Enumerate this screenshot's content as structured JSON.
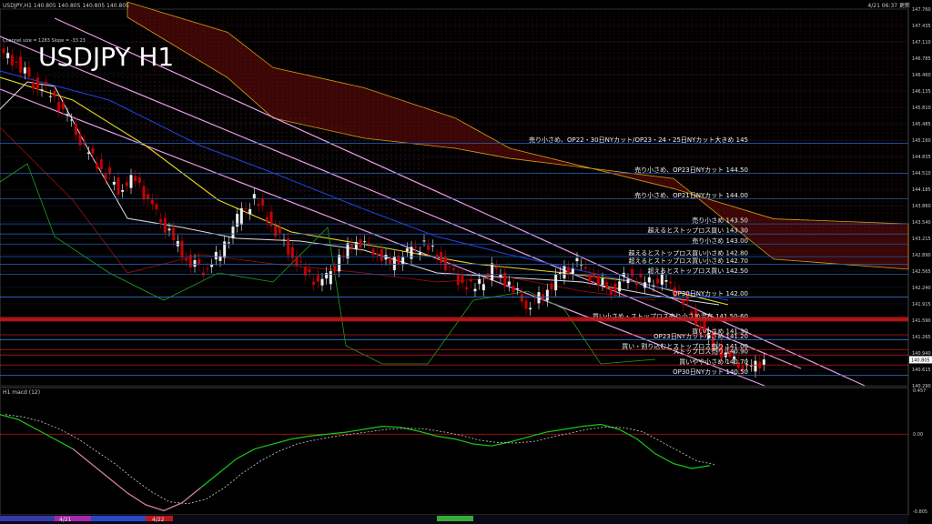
{
  "window": {
    "header_left": "USDJPY,H1 140.805 140.805 140.805 140.805",
    "header_right": "4/21 06:37 更新",
    "channel_info": "Channel size = 1283 Slope = -33.23",
    "big_title": "USDJPY  H1"
  },
  "sub_window": {
    "label": "H1  macd (12)",
    "axis_top": "0.457",
    "axis_mid": "0.00",
    "axis_bottom": "-0.805"
  },
  "date_labels": [
    "4/21",
    "4/22"
  ],
  "price_axis": [
    {
      "v": 147.76,
      "t": "147.760"
    },
    {
      "v": 147.435,
      "t": "147.435"
    },
    {
      "v": 147.11,
      "t": "147.110"
    },
    {
      "v": 146.785,
      "t": "146.785"
    },
    {
      "v": 146.46,
      "t": "146.460"
    },
    {
      "v": 146.135,
      "t": "146.135"
    },
    {
      "v": 145.81,
      "t": "145.810"
    },
    {
      "v": 145.485,
      "t": "145.485"
    },
    {
      "v": 145.16,
      "t": "145.160"
    },
    {
      "v": 144.835,
      "t": "144.835"
    },
    {
      "v": 144.51,
      "t": "144.510"
    },
    {
      "v": 144.185,
      "t": "144.185"
    },
    {
      "v": 143.86,
      "t": "143.860"
    },
    {
      "v": 143.54,
      "t": "143.540"
    },
    {
      "v": 143.215,
      "t": "143.215"
    },
    {
      "v": 142.89,
      "t": "142.890"
    },
    {
      "v": 142.565,
      "t": "142.565"
    },
    {
      "v": 142.24,
      "t": "142.240"
    },
    {
      "v": 141.915,
      "t": "141.915"
    },
    {
      "v": 141.59,
      "t": "141.590"
    },
    {
      "v": 141.265,
      "t": "141.265"
    },
    {
      "v": 140.94,
      "t": "140.940"
    },
    {
      "v": 140.615,
      "t": "140.615"
    },
    {
      "v": 140.29,
      "t": "140.290"
    }
  ],
  "current_price": {
    "v": 140.805,
    "t": "140.805"
  },
  "annotations": [
    {
      "text": "売り小さめ、OP22・30日NYカット/OP23・24・25日NYカット大きめ 145",
      "price": 145.1,
      "kind": "sell"
    },
    {
      "text": "売り小さめ、OP23日NYカット 144.50",
      "price": 144.5,
      "kind": "sell"
    },
    {
      "text": "売り小さめ、OP21日NYカット 144.00",
      "price": 144.0,
      "kind": "sell"
    },
    {
      "text": "売り小さめ 143.50",
      "price": 143.5,
      "kind": "sell"
    },
    {
      "text": "超えるとストップロス買い 143.30",
      "price": 143.3,
      "kind": "stop"
    },
    {
      "text": "売り小さめ 143.00",
      "price": 143.1,
      "kind": "sell"
    },
    {
      "text": "超えるとストップロス買い小さめ 142.80",
      "price": 142.85,
      "kind": "stop"
    },
    {
      "text": "超えるとストップロス買い小さめ 142.70",
      "price": 142.7,
      "kind": "stop"
    },
    {
      "text": "超えるとストップロス買い 142.50",
      "price": 142.5,
      "kind": "stop"
    },
    {
      "text": "OP30日NYカット 142.00",
      "price": 142.05,
      "kind": "op"
    },
    {
      "text": "買い小さめ・ストップロス売り小さめ混在 141.50-60",
      "price": 141.6,
      "kind": "buy"
    },
    {
      "text": "買い小さめ 141.30",
      "price": 141.3,
      "kind": "buy"
    },
    {
      "text": "OP23日NYカット小さめ 141.20",
      "price": 141.2,
      "kind": "op"
    },
    {
      "text": "買い・割り込むとストップロス売り 141.00",
      "price": 141.0,
      "kind": "buy"
    },
    {
      "text": "ストップロス売り 140.90",
      "price": 140.9,
      "kind": "buy"
    },
    {
      "text": "買いやや小さめ 140.70",
      "price": 140.7,
      "kind": "buy"
    },
    {
      "text": "OP30日NYカット 140.50",
      "price": 140.5,
      "kind": "op"
    }
  ],
  "chart_data": [
    {
      "type": "line",
      "title": "USDJPY  H1",
      "series_name": "USDJPY",
      "price_range": [
        140.29,
        147.76
      ],
      "close_path": [
        [
          0,
          146.9
        ],
        [
          4,
          146.7
        ],
        [
          8,
          146.3
        ],
        [
          12,
          146.1
        ],
        [
          16,
          145.6
        ],
        [
          20,
          145.0
        ],
        [
          24,
          144.6
        ],
        [
          28,
          144.2
        ],
        [
          32,
          144.4
        ],
        [
          36,
          143.8
        ],
        [
          40,
          143.3
        ],
        [
          44,
          142.8
        ],
        [
          48,
          142.6
        ],
        [
          52,
          142.9
        ],
        [
          56,
          143.6
        ],
        [
          60,
          144.0
        ],
        [
          64,
          143.5
        ],
        [
          68,
          143.0
        ],
        [
          72,
          142.5
        ],
        [
          76,
          142.3
        ],
        [
          80,
          142.8
        ],
        [
          84,
          143.2
        ],
        [
          88,
          143.0
        ],
        [
          92,
          142.7
        ],
        [
          96,
          142.9
        ],
        [
          100,
          143.1
        ],
        [
          104,
          142.8
        ],
        [
          108,
          142.4
        ],
        [
          112,
          142.2
        ],
        [
          116,
          142.6
        ],
        [
          120,
          142.3
        ],
        [
          124,
          141.9
        ],
        [
          128,
          142.1
        ],
        [
          132,
          142.5
        ],
        [
          136,
          142.7
        ],
        [
          140,
          142.4
        ],
        [
          144,
          142.2
        ],
        [
          148,
          142.5
        ],
        [
          152,
          142.3
        ],
        [
          156,
          142.4
        ],
        [
          160,
          142.1
        ],
        [
          164,
          141.6
        ],
        [
          168,
          141.1
        ],
        [
          172,
          140.8
        ],
        [
          176,
          140.6
        ],
        [
          180,
          140.8
        ]
      ],
      "notes": "USDJPY H1 candles approximate"
    },
    {
      "type": "line",
      "title": "H1  macd (12)",
      "series_name": "macd",
      "ylim": [
        -0.805,
        0.457
      ],
      "values": [
        0.2,
        0.15,
        0.05,
        -0.05,
        -0.15,
        -0.3,
        -0.45,
        -0.6,
        -0.72,
        -0.78,
        -0.7,
        -0.55,
        -0.4,
        -0.25,
        -0.15,
        -0.1,
        -0.05,
        -0.02,
        0.0,
        0.02,
        0.05,
        0.08,
        0.07,
        0.03,
        -0.02,
        -0.05,
        -0.1,
        -0.12,
        -0.08,
        -0.03,
        0.02,
        0.05,
        0.08,
        0.1,
        0.05,
        -0.05,
        -0.2,
        -0.3,
        -0.35,
        -0.32
      ]
    }
  ],
  "colors": {
    "background": "#000000",
    "grid_blue": "#1e5aa8",
    "red_level": "#c01818",
    "trend_pink": "#e89ce8",
    "cloud_red": "#d22020",
    "ma_yellow": "#e8d820",
    "ma_blue": "#2040d8",
    "ma_white": "#e0e0e0",
    "macd_green": "#18c818",
    "macd_pink": "#e070a8",
    "up_candle": "#f0f0f0",
    "down_candle": "#c80000"
  }
}
